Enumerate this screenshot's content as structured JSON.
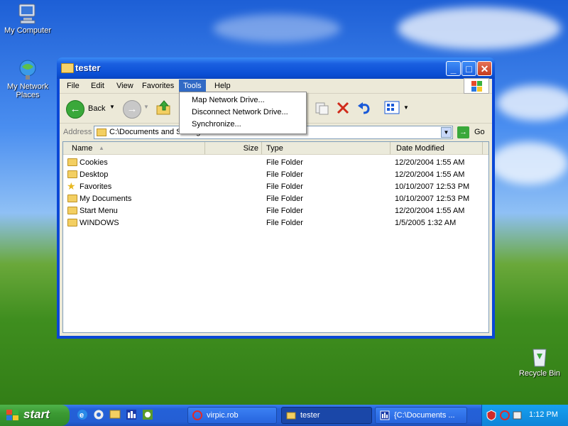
{
  "desktop": {
    "icons": [
      {
        "label": "My Computer",
        "icon": "computer-icon"
      },
      {
        "label": "My Network Places",
        "icon": "network-places-icon"
      },
      {
        "label": "Recycle Bin",
        "icon": "recycle-bin-icon"
      }
    ]
  },
  "window": {
    "title": "tester",
    "menu": [
      "File",
      "Edit",
      "View",
      "Favorites",
      "Tools",
      "Help"
    ],
    "active_menu": "Tools",
    "tools_menu": [
      "Map Network Drive...",
      "Disconnect Network Drive...",
      "Synchronize..."
    ],
    "toolbar": {
      "back_label": "Back"
    },
    "address": {
      "label": "Address",
      "value": "C:\\Documents and Settings\\tester",
      "go_label": "Go"
    },
    "columns": [
      "Name",
      "Size",
      "Type",
      "Date Modified"
    ],
    "files": [
      {
        "name": "Cookies",
        "size": "",
        "type": "File Folder",
        "date": "12/20/2004 1:55 AM",
        "icon": "folder-icon"
      },
      {
        "name": "Desktop",
        "size": "",
        "type": "File Folder",
        "date": "12/20/2004 1:55 AM",
        "icon": "folder-icon"
      },
      {
        "name": "Favorites",
        "size": "",
        "type": "File Folder",
        "date": "10/10/2007 12:53 PM",
        "icon": "favorites-folder-icon"
      },
      {
        "name": "My Documents",
        "size": "",
        "type": "File Folder",
        "date": "10/10/2007 12:53 PM",
        "icon": "folder-icon"
      },
      {
        "name": "Start Menu",
        "size": "",
        "type": "File Folder",
        "date": "12/20/2004 1:55 AM",
        "icon": "folder-icon"
      },
      {
        "name": "WINDOWS",
        "size": "",
        "type": "File Folder",
        "date": "1/5/2005 1:32 AM",
        "icon": "folder-icon"
      }
    ]
  },
  "taskbar": {
    "start_label": "start",
    "tasks": [
      {
        "label": "virpic.rob",
        "icon": "virpic-icon"
      },
      {
        "label": "tester",
        "icon": "folder-icon"
      },
      {
        "label": "{C:\\Documents ...",
        "icon": "app-window-icon"
      }
    ],
    "clock": "1:12 PM"
  },
  "colors": {
    "titlebar": "#0a4ed4",
    "menu_highlight": "#316ac5",
    "start_green": "#3c9a33",
    "taskbar_blue": "#245ed4"
  }
}
